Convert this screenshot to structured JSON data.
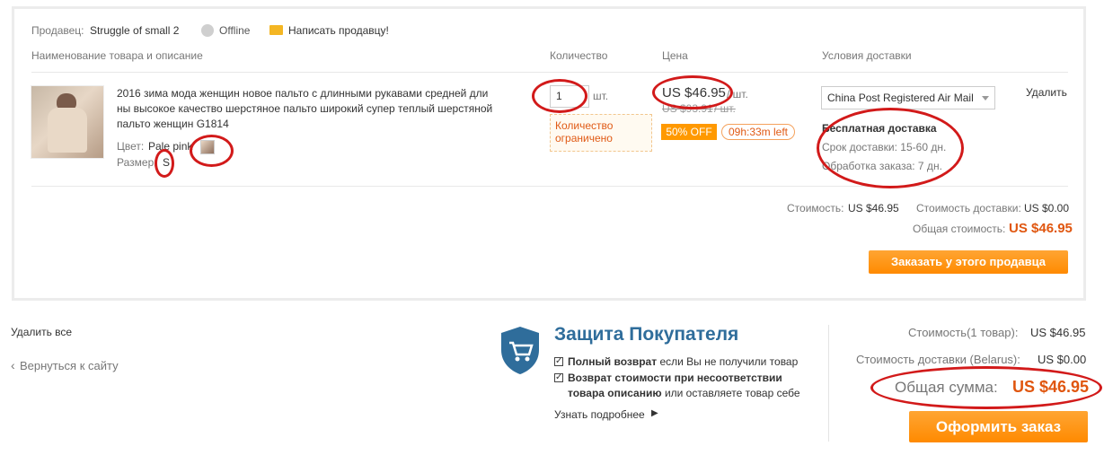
{
  "seller": {
    "label": "Продавец:",
    "name": "Struggle of small 2",
    "status": "Offline",
    "message_link": "Написать продавцу!"
  },
  "columns": {
    "product": "Наименование товара и описание",
    "quantity": "Количество",
    "price": "Цена",
    "shipping": "Условия доставки"
  },
  "item": {
    "title_line1": "2016 зима мода женщин новое пальто с длинными рукавами средней дли",
    "title_line2": "ны высокое качество шерстяное пальто широкий супер теплый шерстяной",
    "title_line3": "пальто женщин G1814",
    "color_label": "Цвет:",
    "color_value": "Pale pink",
    "size_label": "Размер:",
    "size_value": "S",
    "quantity": "1",
    "quantity_unit": "шт.",
    "quantity_warning_line1": "Количество",
    "quantity_warning_line2": "ограничено",
    "price": "US $46.95",
    "price_unit": "/ шт.",
    "old_price": "US $93.91",
    "old_price_unit": "/ шт.",
    "discount": "50% OFF",
    "time_left": "09h:33m left",
    "shipping_method": "China Post Registered Air Mail",
    "free_shipping": "Бесплатная доставка",
    "delivery_time": "Срок доставки: 15-60 дн.",
    "processing_time": "Обработка заказа: 7 дн.",
    "remove": "Удалить"
  },
  "seller_summary": {
    "cost_label": "Стоимость:",
    "cost_value": "US $46.95",
    "shipping_label": "Стоимость доставки:",
    "shipping_value": "US $0.00",
    "total_label": "Общая стоимость:",
    "total_value": "US $46.95",
    "order_button": "Заказать у этого продавца"
  },
  "footer": {
    "remove_all": "Удалить все",
    "back_link": "Вернуться к сайту",
    "protection_title": "Защита Покупателя",
    "protection_1_bold": "Полный возврат",
    "protection_1_rest": " если Вы не получили товар",
    "protection_2_bold_a": "Возврат стоимости при несоответствии",
    "protection_2_bold_b": "товара описанию",
    "protection_2_rest": " или оставляете товар себе",
    "learn_more": "Узнать подробнее",
    "items_cost_label": "Стоимость(1 товар):",
    "items_cost_value": "US $46.95",
    "shipping_label": "Стоимость доставки (Belarus):",
    "shipping_value": "US $0.00",
    "grand_total_label": "Общая сумма:",
    "grand_total_value": "US $46.95",
    "checkout_button": "Оформить заказ"
  },
  "colors": {
    "accent_orange": "#ff8a00",
    "price_orange": "#e0560f",
    "annotation_red": "#d21a1a",
    "shield_blue": "#2f6d9b"
  }
}
